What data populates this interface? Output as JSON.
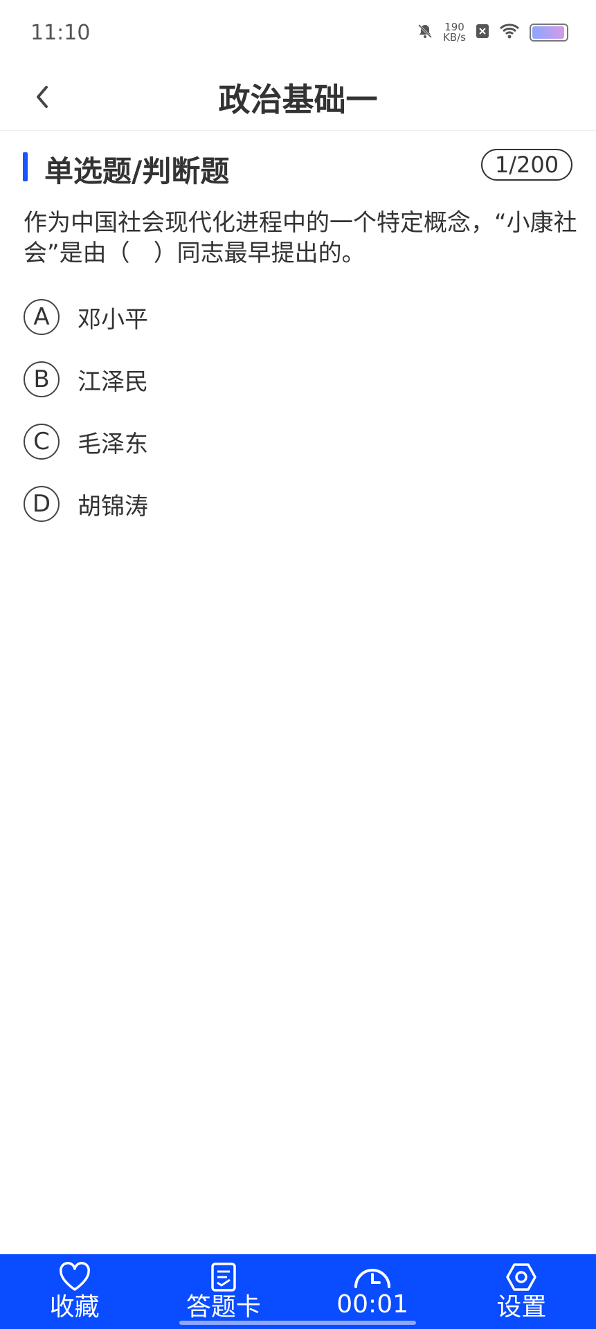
{
  "status": {
    "time": "11:10",
    "speed_value": "190",
    "speed_unit": "KB/s"
  },
  "header": {
    "title": "政治基础一"
  },
  "section": {
    "title": "单选题/判断题",
    "counter": "1/200"
  },
  "question": {
    "text": "作为中国社会现代化进程中的一个特定概念，“小康社会”是由（　）同志最早提出的。"
  },
  "options": [
    {
      "letter": "A",
      "text": "邓小平"
    },
    {
      "letter": "B",
      "text": "江泽民"
    },
    {
      "letter": "C",
      "text": "毛泽东"
    },
    {
      "letter": "D",
      "text": "胡锦涛"
    }
  ],
  "bottom_nav": {
    "favorite_label": "收藏",
    "answer_card_label": "答题卡",
    "timer": "00:01",
    "settings_label": "设置"
  },
  "colors": {
    "accent": "#0a4cff",
    "section_bar": "#1a55ff"
  }
}
